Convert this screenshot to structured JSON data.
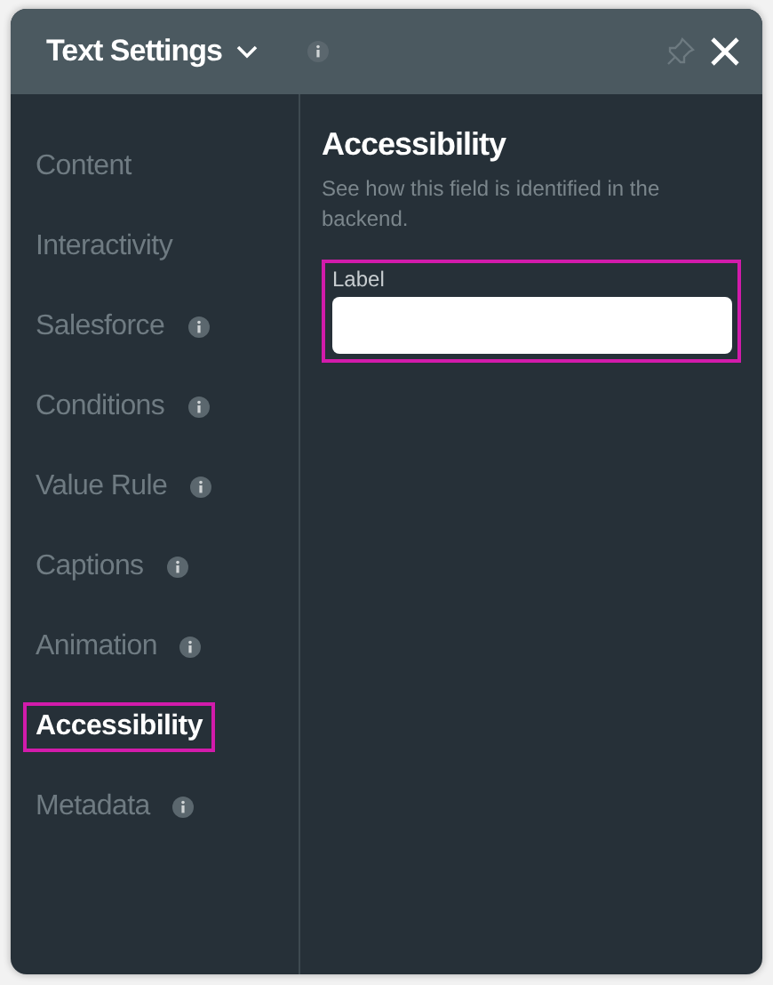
{
  "window": {
    "title": "Text Settings",
    "info": true
  },
  "sidebar": {
    "items": [
      {
        "label": "Content",
        "info": false,
        "selected": false
      },
      {
        "label": "Interactivity",
        "info": false,
        "selected": false
      },
      {
        "label": "Salesforce",
        "info": true,
        "selected": false
      },
      {
        "label": "Conditions",
        "info": true,
        "selected": false
      },
      {
        "label": "Value Rule",
        "info": true,
        "selected": false
      },
      {
        "label": "Captions",
        "info": true,
        "selected": false
      },
      {
        "label": "Animation",
        "info": true,
        "selected": false
      },
      {
        "label": "Accessibility",
        "info": false,
        "selected": true
      },
      {
        "label": "Metadata",
        "info": true,
        "selected": false
      }
    ]
  },
  "panel": {
    "title": "Accessibility",
    "description": "See how this field is identified in the backend.",
    "field": {
      "label": "Label",
      "highlighted": true
    }
  }
}
